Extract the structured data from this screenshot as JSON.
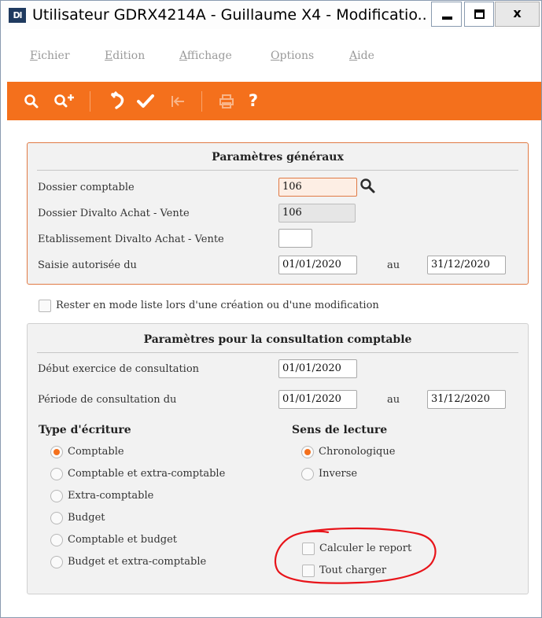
{
  "window": {
    "icon_text": "Dl",
    "title": "Utilisateur GDRX4214A - Guillaume X4 - Modificatio...",
    "close_symbol": "x"
  },
  "menu": {
    "items": [
      {
        "accel": "F",
        "rest": "ichier"
      },
      {
        "accel": "E",
        "rest": "dition"
      },
      {
        "accel": "A",
        "rest": "ffichage"
      },
      {
        "accel": "O",
        "rest": "ptions"
      },
      {
        "accel": "A",
        "rest": "ide"
      }
    ]
  },
  "toolbar": {
    "icons": [
      "search-icon",
      "zoom-plus-icon",
      "undo-icon",
      "check-icon",
      "first-record-icon",
      "print-icon",
      "help-icon"
    ],
    "help_symbol": "?",
    "accent_color": "#f4701c"
  },
  "general": {
    "title": "Paramètres généraux",
    "dossier_comptable_label": "Dossier comptable",
    "dossier_comptable_value": "106",
    "dossier_divalto_label": "Dossier Divalto Achat - Vente",
    "dossier_divalto_value": "106",
    "etablissement_label": "Etablissement Divalto Achat - Vente",
    "etablissement_value": "",
    "saisie_label": "Saisie autorisée du",
    "saisie_from": "01/01/2020",
    "saisie_au": "au",
    "saisie_to": "31/12/2020"
  },
  "rester_liste_label": "Rester en mode liste lors d'une création ou d'une modification",
  "consultation": {
    "title": "Paramètres pour la consultation comptable",
    "debut_label": "Début exercice de consultation",
    "debut_value": "01/01/2020",
    "periode_label": "Période de consultation du",
    "periode_from": "01/01/2020",
    "periode_au": "au",
    "periode_to": "31/12/2020",
    "type_heading": "Type d'écriture",
    "type_options": [
      "Comptable",
      "Comptable et extra-comptable",
      "Extra-comptable",
      "Budget",
      "Comptable et budget",
      "Budget et extra-comptable"
    ],
    "type_selected": "Comptable",
    "sens_heading": "Sens de lecture",
    "sens_options": [
      "Chronologique",
      "Inverse"
    ],
    "sens_selected": "Chronologique",
    "calculer_report_label": "Calculer le report",
    "tout_charger_label": "Tout charger"
  }
}
